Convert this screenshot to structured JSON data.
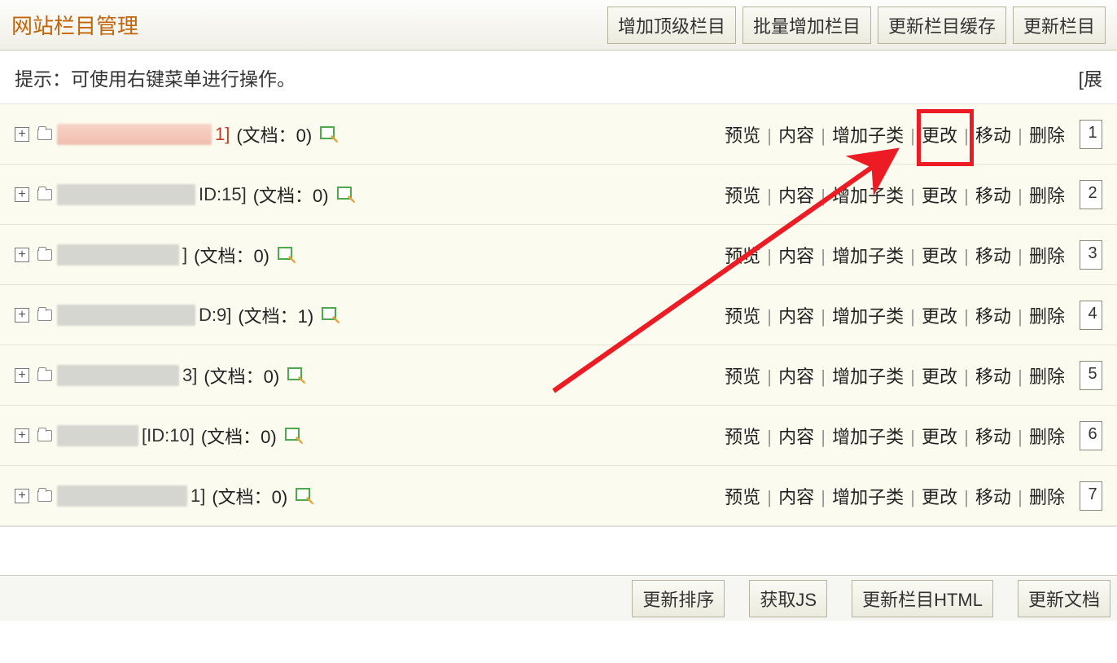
{
  "header": {
    "title": "网站栏目管理",
    "btn_add_top": "增加顶级栏目",
    "btn_batch_add": "批量增加栏目",
    "btn_refresh_cache": "更新栏目缓存",
    "btn_refresh_col": "更新栏目"
  },
  "hint": {
    "text": "提示：可使用右键菜单进行操作。",
    "expand": "[展"
  },
  "actions": {
    "preview": "预览",
    "content": "内容",
    "addsub": "增加子类",
    "modify": "更改",
    "move": "移动",
    "delete": "删除"
  },
  "rows": [
    {
      "id_text": "1]",
      "id_red": true,
      "doc": "(文档：0)",
      "sort": "1",
      "redW": 190,
      "redC": "red1",
      "pre": ""
    },
    {
      "id_text": "ID:15]",
      "id_red": false,
      "doc": "(文档：0)",
      "sort": "2",
      "redW": 170,
      "redC": "",
      "pre": ""
    },
    {
      "id_text": "]",
      "id_red": false,
      "doc": "(文档：0)",
      "sort": "3",
      "redW": 150,
      "redC": "",
      "pre": ""
    },
    {
      "id_text": "D:9]",
      "id_red": false,
      "doc": "(文档：1)",
      "sort": "4",
      "redW": 170,
      "redC": "",
      "pre": ""
    },
    {
      "id_text": "3]",
      "id_red": false,
      "doc": "(文档：0)",
      "sort": "5",
      "redW": 150,
      "redC": "",
      "pre": ""
    },
    {
      "id_text": "[ID:10]",
      "id_red": false,
      "doc": "(文档：0)",
      "sort": "6",
      "redW": 100,
      "redC": "",
      "pre": ""
    },
    {
      "id_text": "1]",
      "id_red": false,
      "doc": "(文档：0)",
      "sort": "7",
      "redW": 160,
      "redC": "",
      "pre": ""
    }
  ],
  "footer": {
    "btn_sort": "更新排序",
    "btn_js": "获取JS",
    "btn_html": "更新栏目HTML",
    "btn_doc": "更新文档"
  }
}
